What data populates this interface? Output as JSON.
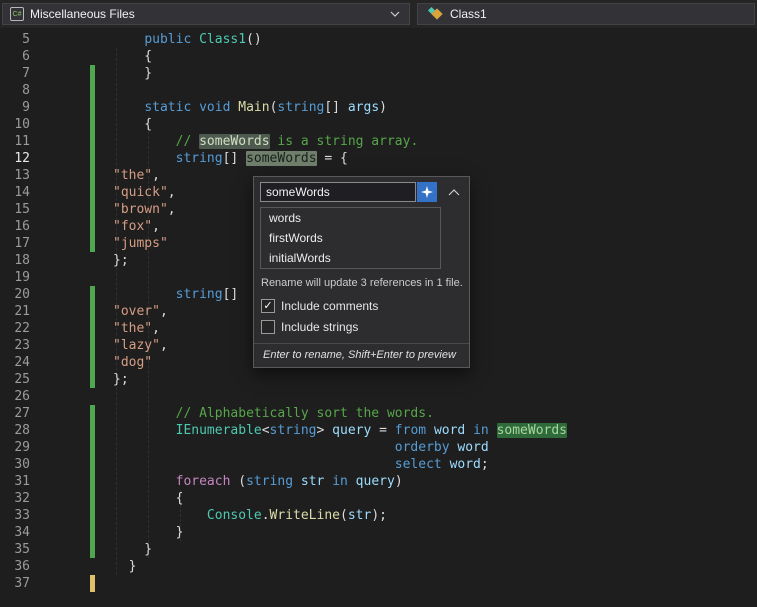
{
  "titlebar": {
    "project_dropdown": {
      "label": "Miscellaneous Files",
      "icon": "csharp-file-icon",
      "icon_text": "C#"
    },
    "type_dropdown": {
      "label": "Class1",
      "icon": "class-icon"
    }
  },
  "rename_popup": {
    "input_value": "someWords",
    "suggestions": [
      "words",
      "firstWords",
      "initialWords"
    ],
    "info": "Rename will update 3 references in 1 file.",
    "checkboxes": [
      {
        "label": "Include comments",
        "checked": true
      },
      {
        "label": "Include strings",
        "checked": false
      }
    ],
    "footer": "Enter to rename, Shift+Enter to preview",
    "colors": {
      "accent_button": "#3472c8"
    }
  },
  "editor": {
    "colors": {
      "background": "#1e1e1e",
      "keyword": "#569cd6",
      "control_keyword": "#c586c0",
      "type": "#4ec9b0",
      "method": "#dcdcaa",
      "variable": "#9cdcfe",
      "string": "#d69d85",
      "comment": "#57a64a",
      "change_bar_saved": "#4fa74f",
      "change_bar_unsaved": "#e0c06a"
    },
    "lines": [
      {
        "n": "5",
        "bar": "",
        "tokens": [
          [
            "pln",
            "    "
          ],
          [
            "kw",
            "public"
          ],
          [
            "pln",
            " "
          ],
          [
            "type",
            "Class1"
          ],
          [
            "pln",
            "()"
          ]
        ]
      },
      {
        "n": "6",
        "bar": "",
        "tokens": [
          [
            "pln",
            "    {"
          ]
        ]
      },
      {
        "n": "7",
        "bar": "green",
        "tokens": [
          [
            "pln",
            "    }"
          ]
        ]
      },
      {
        "n": "8",
        "bar": "green",
        "tokens": []
      },
      {
        "n": "9",
        "bar": "green",
        "tokens": [
          [
            "pln",
            "    "
          ],
          [
            "kw",
            "static"
          ],
          [
            "pln",
            " "
          ],
          [
            "kw",
            "void"
          ],
          [
            "pln",
            " "
          ],
          [
            "method",
            "Main"
          ],
          [
            "pln",
            "("
          ],
          [
            "kw",
            "string"
          ],
          [
            "pln",
            "[] "
          ],
          [
            "var",
            "args"
          ],
          [
            "pln",
            ")"
          ]
        ]
      },
      {
        "n": "10",
        "bar": "green",
        "tokens": [
          [
            "pln",
            "    {"
          ]
        ]
      },
      {
        "n": "11",
        "bar": "green",
        "tokens": [
          [
            "pln",
            "        "
          ],
          [
            "com",
            "// "
          ],
          [
            "com hlcom",
            "someWords"
          ],
          [
            "com",
            " is a string array."
          ]
        ]
      },
      {
        "n": "12",
        "bar": "green",
        "current": true,
        "tokens": [
          [
            "pln",
            "        "
          ],
          [
            "kw",
            "string"
          ],
          [
            "pln",
            "[] "
          ],
          [
            "var hlactive",
            "someWords"
          ],
          [
            "pln",
            " = {"
          ]
        ]
      },
      {
        "n": "13",
        "bar": "green",
        "tokens": [
          [
            "str",
            "\"the\""
          ],
          [
            "pln",
            ","
          ]
        ]
      },
      {
        "n": "14",
        "bar": "green",
        "tokens": [
          [
            "str",
            "\"quick\""
          ],
          [
            "pln",
            ","
          ]
        ]
      },
      {
        "n": "15",
        "bar": "green",
        "tokens": [
          [
            "str",
            "\"brown\""
          ],
          [
            "pln",
            ","
          ]
        ]
      },
      {
        "n": "16",
        "bar": "green",
        "tokens": [
          [
            "str",
            "\"fox\""
          ],
          [
            "pln",
            ","
          ]
        ]
      },
      {
        "n": "17",
        "bar": "green",
        "tokens": [
          [
            "str",
            "\"jumps\""
          ]
        ]
      },
      {
        "n": "18",
        "bar": "",
        "tokens": [
          [
            "pln",
            "};"
          ]
        ]
      },
      {
        "n": "19",
        "bar": "",
        "tokens": []
      },
      {
        "n": "20",
        "bar": "green",
        "tokens": [
          [
            "pln",
            "        "
          ],
          [
            "kw",
            "string"
          ],
          [
            "pln",
            "[]"
          ]
        ]
      },
      {
        "n": "21",
        "bar": "green",
        "tokens": [
          [
            "str",
            "\"over\""
          ],
          [
            "pln",
            ","
          ]
        ]
      },
      {
        "n": "22",
        "bar": "green",
        "tokens": [
          [
            "str",
            "\"the\""
          ],
          [
            "pln",
            ","
          ]
        ]
      },
      {
        "n": "23",
        "bar": "green",
        "tokens": [
          [
            "str",
            "\"lazy\""
          ],
          [
            "pln",
            ","
          ]
        ]
      },
      {
        "n": "24",
        "bar": "green",
        "tokens": [
          [
            "str",
            "\"dog\""
          ]
        ]
      },
      {
        "n": "25",
        "bar": "green",
        "tokens": [
          [
            "pln",
            "};"
          ]
        ]
      },
      {
        "n": "26",
        "bar": "",
        "tokens": []
      },
      {
        "n": "27",
        "bar": "green",
        "tokens": [
          [
            "pln",
            "        "
          ],
          [
            "com",
            "// Alphabetically sort the words."
          ]
        ]
      },
      {
        "n": "28",
        "bar": "green",
        "tokens": [
          [
            "pln",
            "        "
          ],
          [
            "type",
            "IEnumerable"
          ],
          [
            "pln",
            "<"
          ],
          [
            "kw",
            "string"
          ],
          [
            "pln",
            "> "
          ],
          [
            "var",
            "query"
          ],
          [
            "pln",
            " = "
          ],
          [
            "kw",
            "from"
          ],
          [
            "pln",
            " "
          ],
          [
            "var",
            "word"
          ],
          [
            "pln",
            " "
          ],
          [
            "kw",
            "in"
          ],
          [
            "pln",
            " "
          ],
          [
            "var hlgreen",
            "someWords"
          ]
        ]
      },
      {
        "n": "29",
        "bar": "green",
        "tokens": [
          [
            "pln",
            "                                    "
          ],
          [
            "kw",
            "orderby"
          ],
          [
            "pln",
            " "
          ],
          [
            "var",
            "word"
          ]
        ]
      },
      {
        "n": "30",
        "bar": "green",
        "tokens": [
          [
            "pln",
            "                                    "
          ],
          [
            "kw",
            "select"
          ],
          [
            "pln",
            " "
          ],
          [
            "var",
            "word"
          ],
          [
            "pln",
            ";"
          ]
        ]
      },
      {
        "n": "31",
        "bar": "green",
        "tokens": [
          [
            "pln",
            "        "
          ],
          [
            "ctl",
            "foreach"
          ],
          [
            "pln",
            " ("
          ],
          [
            "kw",
            "string"
          ],
          [
            "pln",
            " "
          ],
          [
            "var",
            "str"
          ],
          [
            "pln",
            " "
          ],
          [
            "kw",
            "in"
          ],
          [
            "pln",
            " "
          ],
          [
            "var",
            "query"
          ],
          [
            "pln",
            ")"
          ]
        ]
      },
      {
        "n": "32",
        "bar": "green",
        "tokens": [
          [
            "pln",
            "        {"
          ]
        ]
      },
      {
        "n": "33",
        "bar": "green",
        "tokens": [
          [
            "pln",
            "            "
          ],
          [
            "type",
            "Console"
          ],
          [
            "pln",
            "."
          ],
          [
            "method",
            "WriteLine"
          ],
          [
            "pln",
            "("
          ],
          [
            "var",
            "str"
          ],
          [
            "pln",
            ");"
          ]
        ]
      },
      {
        "n": "34",
        "bar": "green",
        "tokens": [
          [
            "pln",
            "        }"
          ]
        ]
      },
      {
        "n": "35",
        "bar": "green",
        "tokens": [
          [
            "pln",
            "    }"
          ]
        ]
      },
      {
        "n": "36",
        "bar": "",
        "tokens": [
          [
            "pln",
            "  }"
          ]
        ]
      },
      {
        "n": "37",
        "bar": "yellow",
        "tokens": []
      }
    ]
  }
}
